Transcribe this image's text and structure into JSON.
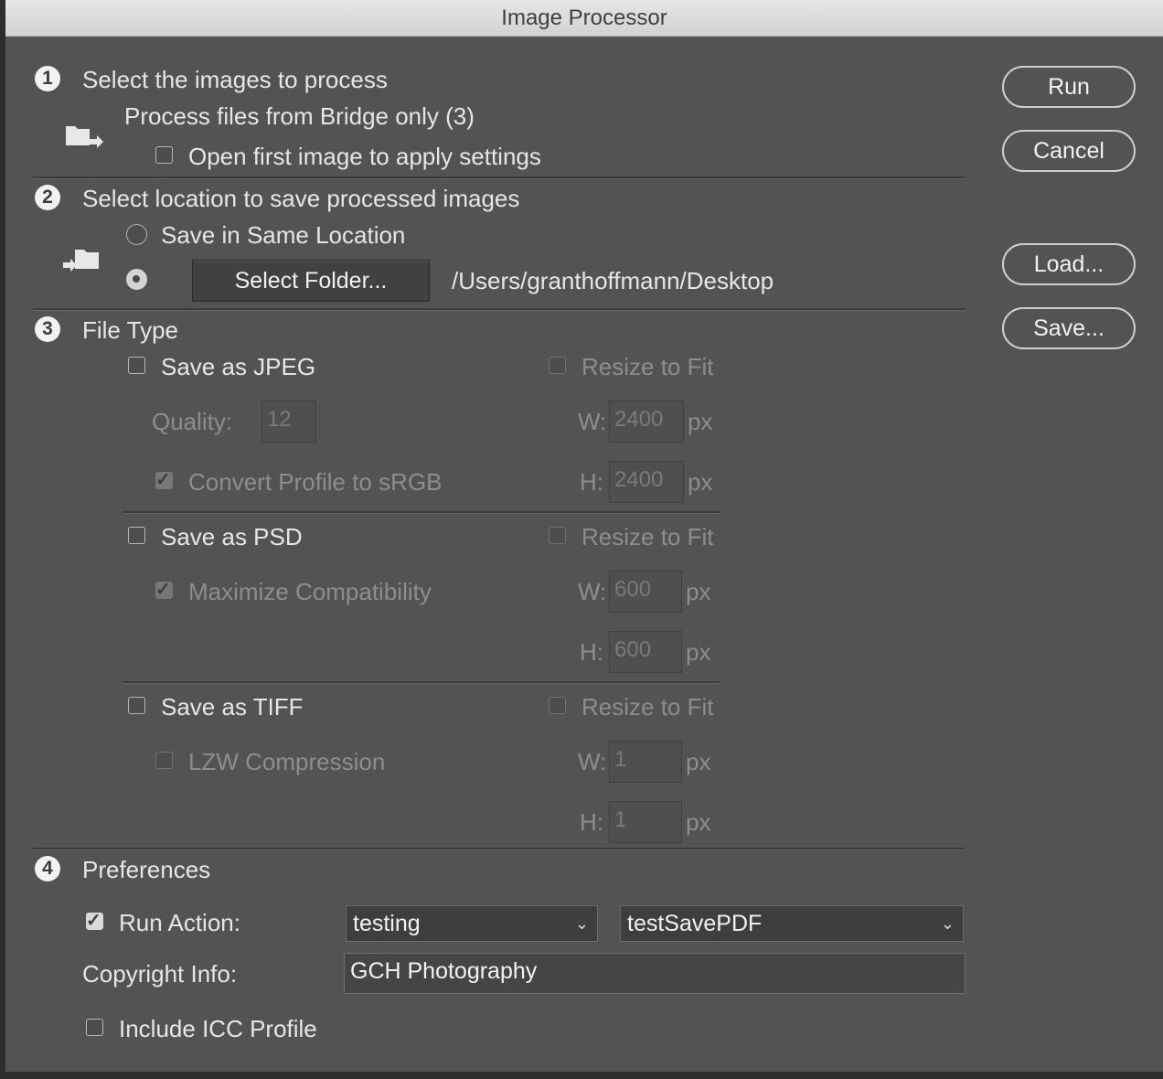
{
  "window": {
    "title": "Image Processor"
  },
  "buttons": {
    "run": "Run",
    "cancel": "Cancel",
    "load": "Load...",
    "save": "Save..."
  },
  "step1": {
    "number": "1",
    "heading": "Select the images to process",
    "source": "Process files from Bridge only (3)",
    "open_first_label": "Open first image to apply settings",
    "open_first_checked": false
  },
  "step2": {
    "number": "2",
    "heading": "Select location to save processed images",
    "same_location_label": "Save in Same Location",
    "select_folder_button": "Select Folder...",
    "folder_path": "/Users/granthoffmann/Desktop",
    "selected_option": "select-folder"
  },
  "step3": {
    "number": "3",
    "heading": "File Type",
    "jpeg": {
      "label": "Save as JPEG",
      "checked": false,
      "quality_label": "Quality:",
      "quality_value": "12",
      "convert_label": "Convert Profile to sRGB",
      "convert_checked": true,
      "resize_label": "Resize to Fit",
      "resize_checked": false,
      "w_label": "W:",
      "w_value": "2400",
      "h_label": "H:",
      "h_value": "2400",
      "unit": "px"
    },
    "psd": {
      "label": "Save as PSD",
      "checked": false,
      "maximize_label": "Maximize Compatibility",
      "maximize_checked": true,
      "resize_label": "Resize to Fit",
      "resize_checked": false,
      "w_label": "W:",
      "w_value": "600",
      "h_label": "H:",
      "h_value": "600",
      "unit": "px"
    },
    "tiff": {
      "label": "Save as TIFF",
      "checked": false,
      "lzw_label": "LZW Compression",
      "lzw_checked": false,
      "resize_label": "Resize to Fit",
      "resize_checked": false,
      "w_label": "W:",
      "w_value": "1",
      "h_label": "H:",
      "h_value": "1",
      "unit": "px"
    }
  },
  "step4": {
    "number": "4",
    "heading": "Preferences",
    "run_action_label": "Run Action:",
    "run_action_checked": true,
    "action_set": "testing",
    "action_name": "testSavePDF",
    "copyright_label": "Copyright Info:",
    "copyright_value": "GCH Photography",
    "icc_label": "Include ICC Profile",
    "icc_checked": false
  }
}
